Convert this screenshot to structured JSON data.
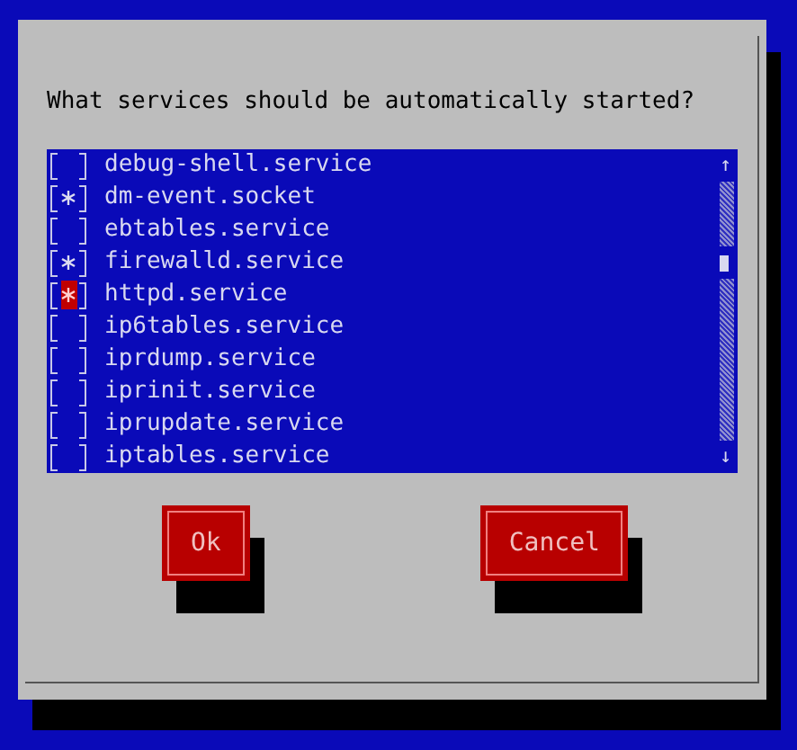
{
  "dialog": {
    "prompt": "What services should be automatically started?",
    "services": [
      {
        "name": "debug-shell.service",
        "checked": false,
        "selected": false
      },
      {
        "name": "dm-event.socket",
        "checked": true,
        "selected": false
      },
      {
        "name": "ebtables.service",
        "checked": false,
        "selected": false
      },
      {
        "name": "firewalld.service",
        "checked": true,
        "selected": false
      },
      {
        "name": "httpd.service",
        "checked": true,
        "selected": true
      },
      {
        "name": "ip6tables.service",
        "checked": false,
        "selected": false
      },
      {
        "name": "iprdump.service",
        "checked": false,
        "selected": false
      },
      {
        "name": "iprinit.service",
        "checked": false,
        "selected": false
      },
      {
        "name": "iprupdate.service",
        "checked": false,
        "selected": false
      },
      {
        "name": "iptables.service",
        "checked": false,
        "selected": false
      }
    ],
    "scroll_up": "↑",
    "scroll_down": "↓",
    "buttons": [
      "Ok",
      "Cancel"
    ]
  }
}
